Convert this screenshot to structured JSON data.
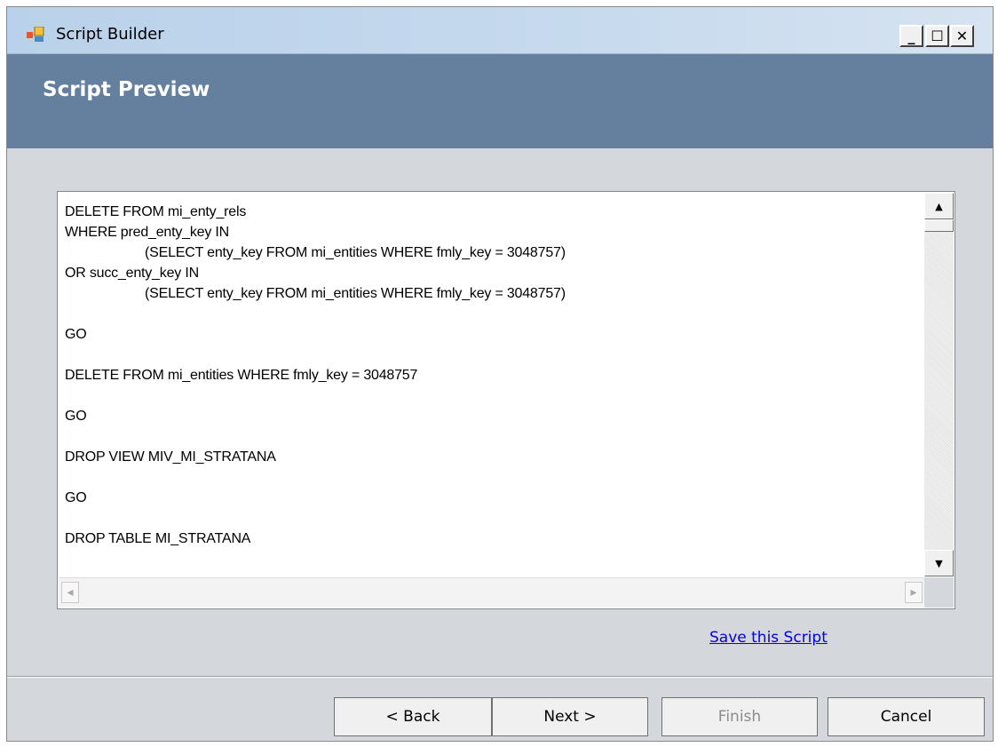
{
  "window": {
    "title": "Script Builder",
    "controls": {
      "minimize": "_",
      "maximize": "☐",
      "close": "✕"
    }
  },
  "header": {
    "title": "Script Preview"
  },
  "script": {
    "lines": [
      {
        "text": "DELETE FROM mi_enty_rels",
        "indent": false
      },
      {
        "text": "WHERE pred_enty_key IN",
        "indent": false
      },
      {
        "text": "(SELECT enty_key FROM mi_entities WHERE fmly_key = 3048757)",
        "indent": true
      },
      {
        "text": "OR succ_enty_key IN",
        "indent": false
      },
      {
        "text": "(SELECT enty_key FROM mi_entities WHERE fmly_key = 3048757)",
        "indent": true
      },
      {
        "text": "",
        "indent": false
      },
      {
        "text": "GO",
        "indent": false
      },
      {
        "text": "",
        "indent": false
      },
      {
        "text": "DELETE FROM mi_entities WHERE fmly_key = 3048757",
        "indent": false
      },
      {
        "text": "",
        "indent": false
      },
      {
        "text": "GO",
        "indent": false
      },
      {
        "text": "",
        "indent": false
      },
      {
        "text": "DROP VIEW MIV_MI_STRATANA",
        "indent": false
      },
      {
        "text": "",
        "indent": false
      },
      {
        "text": "GO",
        "indent": false
      },
      {
        "text": "",
        "indent": false
      },
      {
        "text": "DROP TABLE MI_STRATANA",
        "indent": false
      }
    ]
  },
  "links": {
    "save_script": "Save this Script"
  },
  "buttons": {
    "back": "< Back",
    "next": "Next >",
    "finish": "Finish",
    "cancel": "Cancel"
  },
  "colors": {
    "header_bg": "#65809f",
    "window_bg": "#d4d7dc",
    "link": "#0000ee",
    "disabled_text": "#8b8b8b"
  }
}
